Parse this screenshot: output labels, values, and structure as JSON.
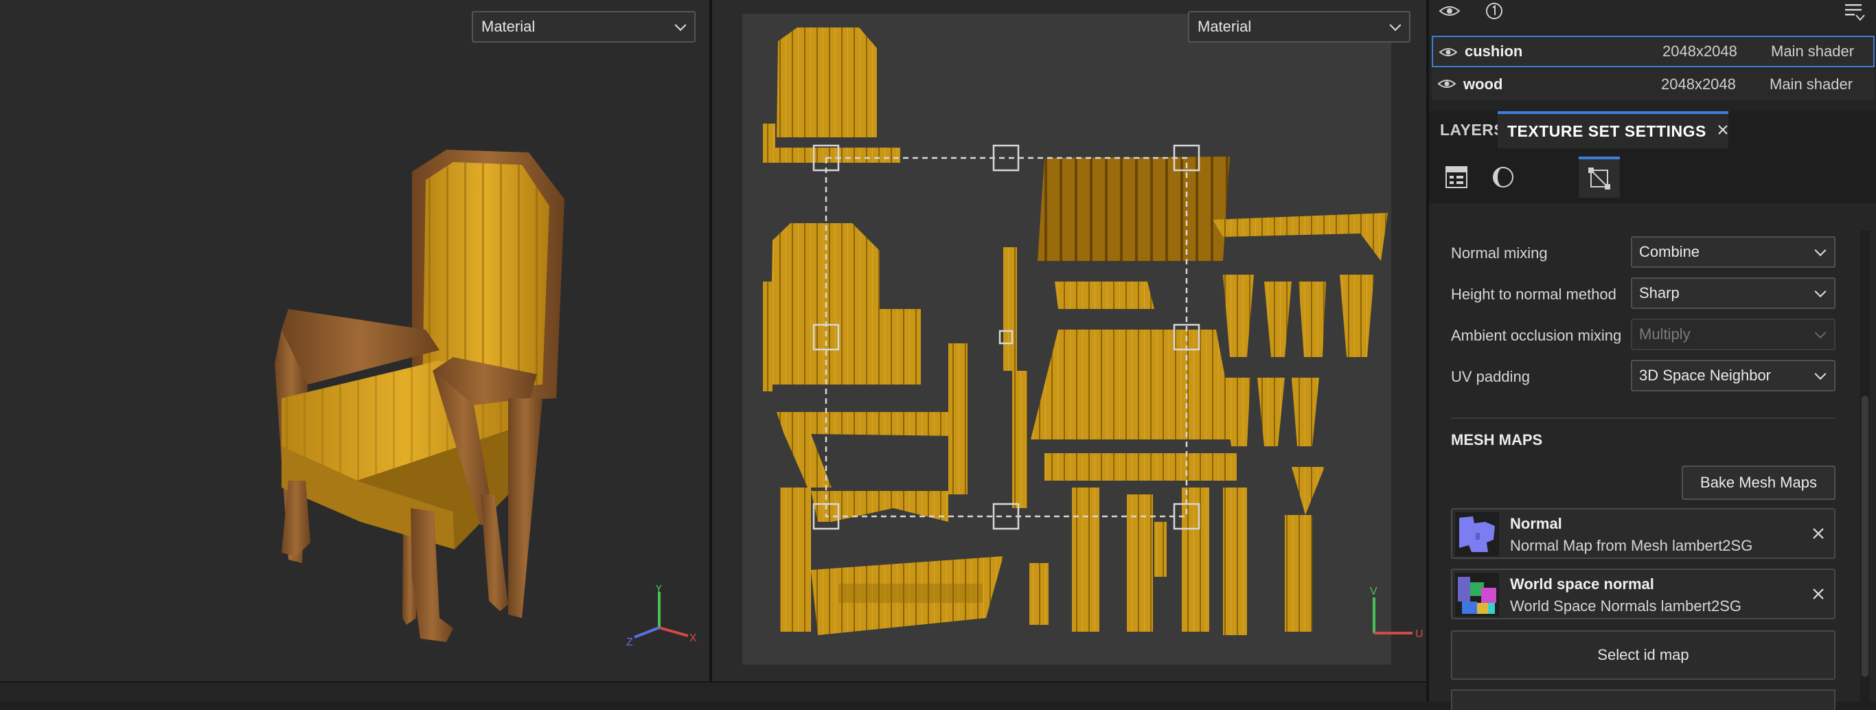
{
  "viewport3d": {
    "material_select": "Material"
  },
  "viewport2d": {
    "material_select": "Material"
  },
  "gizmo3d": {
    "x": "X",
    "y": "Y",
    "z": "Z"
  },
  "gizmo2d": {
    "v": "V",
    "u": "U"
  },
  "texture_sets": [
    {
      "name": "cushion",
      "resolution": "2048x2048",
      "shader": "Main shader",
      "selected": true
    },
    {
      "name": "wood",
      "resolution": "2048x2048",
      "shader": "Main shader",
      "selected": false
    }
  ],
  "tabs": {
    "layers": "LAYERS",
    "texture_set_settings": "TEXTURE SET SETTINGS"
  },
  "settings": {
    "normal_mixing": {
      "label": "Normal mixing",
      "value": "Combine"
    },
    "height_to_normal": {
      "label": "Height to normal method",
      "value": "Sharp"
    },
    "ao_mixing": {
      "label": "Ambient occlusion mixing",
      "value": "Multiply",
      "disabled": true
    },
    "uv_padding": {
      "label": "UV padding",
      "value": "3D Space Neighbor"
    }
  },
  "mesh_maps": {
    "title": "MESH MAPS",
    "bake_button": "Bake Mesh Maps",
    "items": [
      {
        "title": "Normal",
        "subtitle": "Normal Map from Mesh lambert2SG",
        "icon": "normal-map-thumbnail"
      },
      {
        "title": "World space normal",
        "subtitle": "World Space Normals lambert2SG",
        "icon": "world-normal-thumbnail"
      }
    ],
    "select_id_map": "Select id map"
  },
  "colors": {
    "accent": "#3d7fd8",
    "fabric": "#d8a21f",
    "wood": "#8a5a2b",
    "background": "#2b2b2b"
  }
}
